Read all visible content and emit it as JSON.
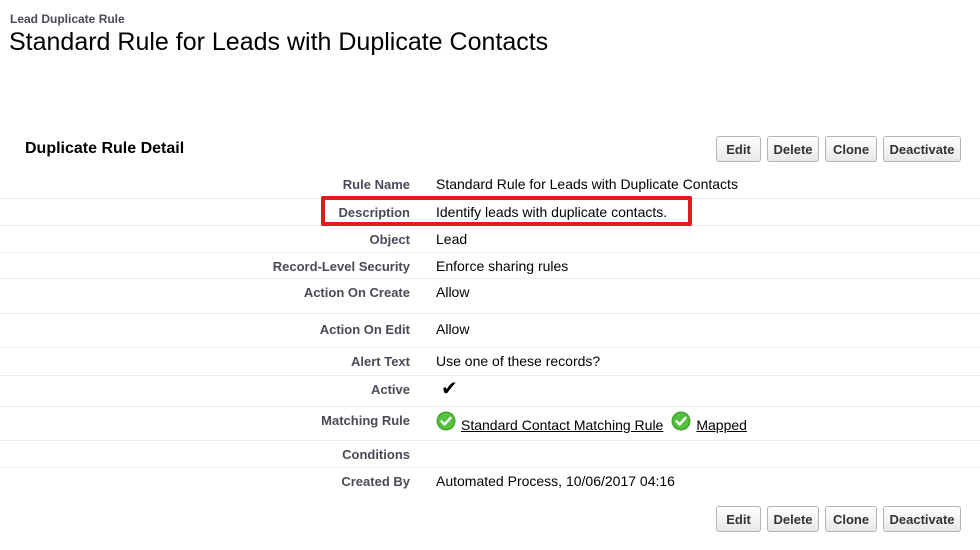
{
  "header": {
    "type": "Lead Duplicate Rule",
    "title": "Standard Rule for Leads with Duplicate Contacts"
  },
  "section": {
    "title": "Duplicate Rule Detail"
  },
  "buttons": {
    "edit": "Edit",
    "delete": "Delete",
    "clone": "Clone",
    "deactivate": "Deactivate"
  },
  "fields": {
    "rule_name": {
      "label": "Rule Name",
      "value": "Standard Rule for Leads with Duplicate Contacts"
    },
    "description": {
      "label": "Description",
      "value": "Identify leads with duplicate contacts."
    },
    "object": {
      "label": "Object",
      "value": "Lead"
    },
    "record_security": {
      "label": "Record-Level Security",
      "value": "Enforce sharing rules"
    },
    "action_on_create": {
      "label": "Action On Create",
      "value": "Allow"
    },
    "action_on_edit": {
      "label": "Action On Edit",
      "value": "Allow"
    },
    "alert_text": {
      "label": "Alert Text",
      "value": "Use one of these records?"
    },
    "active": {
      "label": "Active",
      "value": "✔",
      "checked": true
    },
    "matching_rule": {
      "label": "Matching Rule",
      "link": "Standard Contact Matching Rule",
      "mapped": "Mapped"
    },
    "conditions": {
      "label": "Conditions",
      "value": ""
    },
    "created_by": {
      "label": "Created By",
      "value": "Automated Process, 10/06/2017 04:16"
    }
  },
  "icons": {
    "success": "green-check-circle-icon",
    "highlight_color": "#e3191e"
  }
}
